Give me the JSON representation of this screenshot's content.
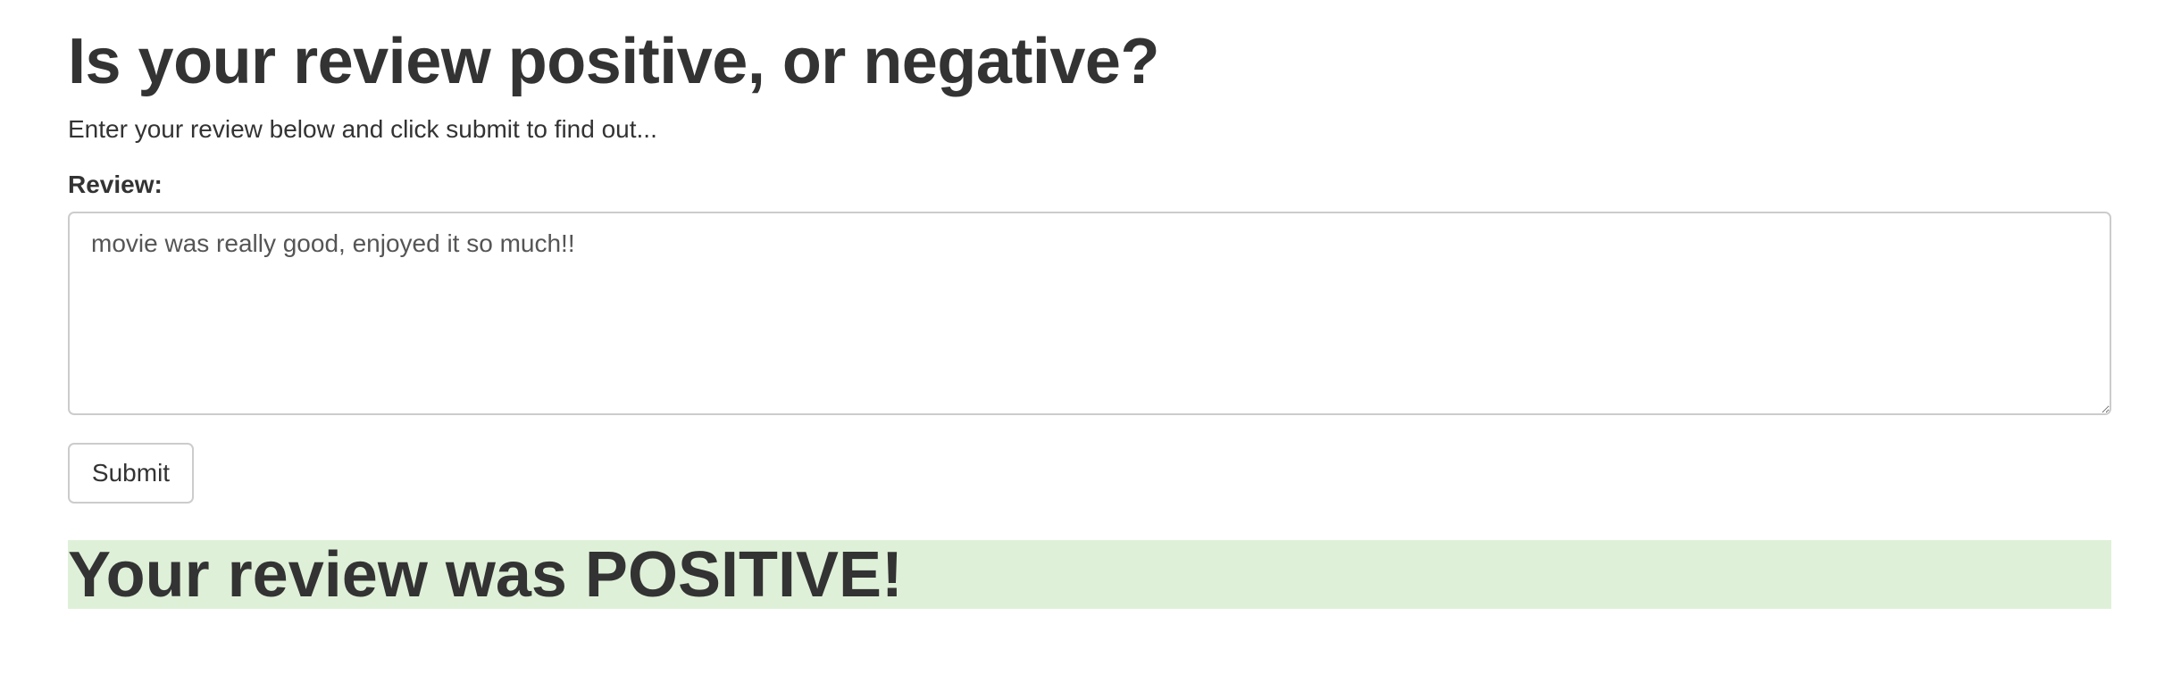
{
  "page": {
    "title": "Is your review positive, or negative?",
    "subtitle": "Enter your review below and click submit to find out..."
  },
  "form": {
    "review_label": "Review:",
    "review_value": "movie was really good, enjoyed it so much!!",
    "submit_label": "Submit"
  },
  "result": {
    "text": "Your review was POSITIVE!",
    "background_color": "#dff0d8"
  }
}
